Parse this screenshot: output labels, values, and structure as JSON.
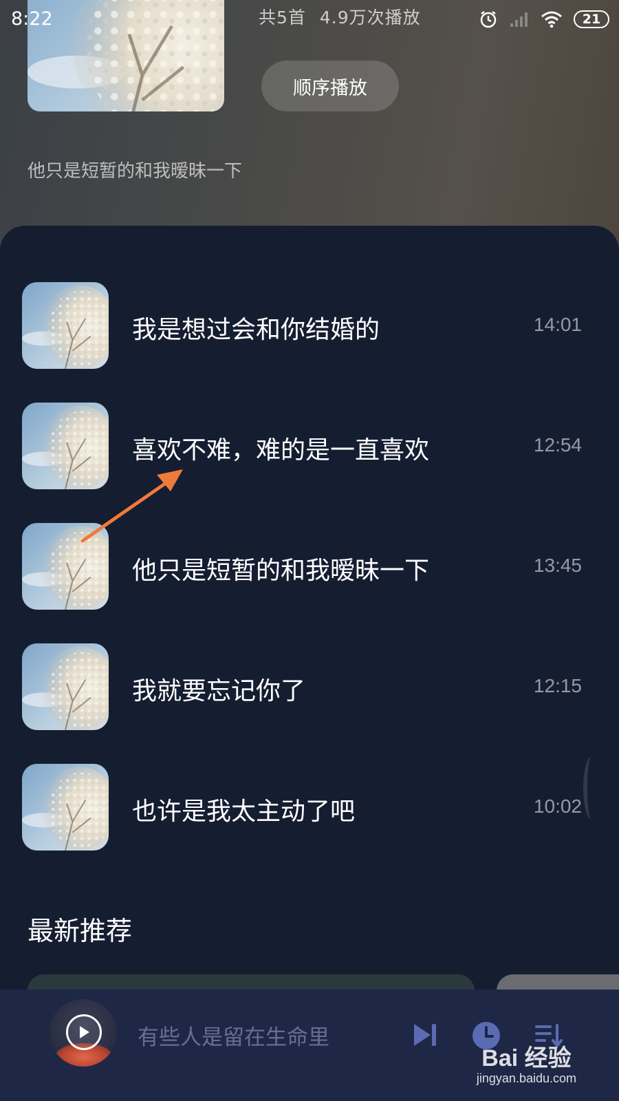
{
  "status_bar": {
    "time": "8:22",
    "battery": "21",
    "icons": [
      "alarm-icon",
      "cell-signal-icon",
      "wifi-icon",
      "battery-icon"
    ]
  },
  "playlist": {
    "song_count": "共5首",
    "play_count": "4.9万次播放",
    "play_order_label": "顺序播放",
    "description": "他只是短暂的和我暧昧一下"
  },
  "songs": [
    {
      "title": "我是想过会和你结婚的",
      "duration": "14:01"
    },
    {
      "title": "喜欢不难，难的是一直喜欢",
      "duration": "12:54"
    },
    {
      "title": "他只是短暂的和我暧昧一下",
      "duration": "13:45"
    },
    {
      "title": "我就要忘记你了",
      "duration": "12:15"
    },
    {
      "title": "也许是我太主动了吧",
      "duration": "10:02"
    }
  ],
  "recommend": {
    "section_title": "最新推荐"
  },
  "player": {
    "now_playing": "有些人是留在生命里",
    "controls": [
      "play-icon",
      "skip-next-icon",
      "timer-icon",
      "playlist-icon"
    ]
  },
  "watermark": {
    "main": "Bai 经验",
    "sub": "jingyan.baidu.com"
  },
  "colors": {
    "panel_bg": "#151d31",
    "player_bg": "#1e2745",
    "accent_arrow": "#f07a3a",
    "control_icon": "#5b6bb3"
  }
}
